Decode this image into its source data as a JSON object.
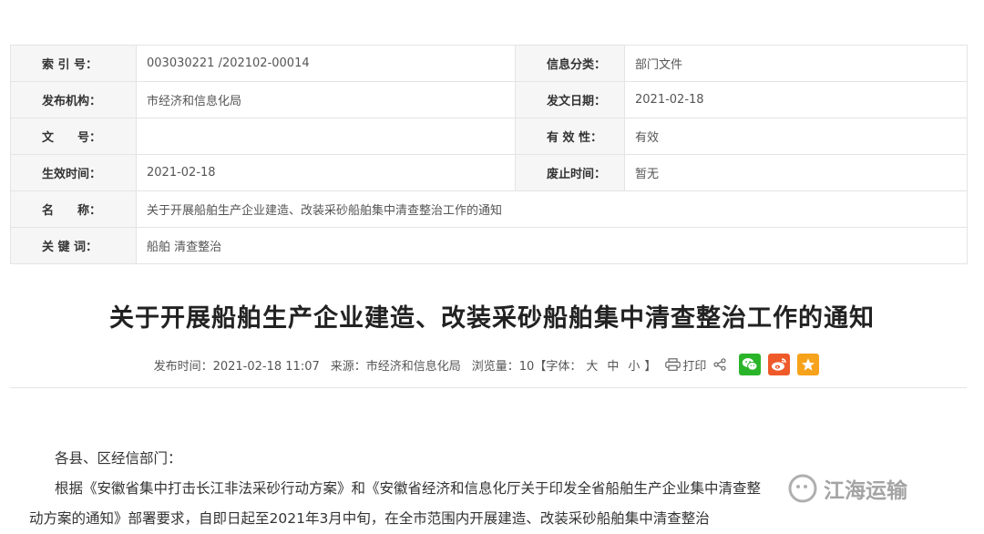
{
  "meta": {
    "index_no_label": "索 引 号：",
    "index_no": "003030221 /202102-00014",
    "category_label": "信息分类：",
    "category": "部门文件",
    "publisher_label": "发布机构：",
    "publisher": "市经济和信息化局",
    "issue_date_label": "发文日期：",
    "issue_date": "2021-02-18",
    "doc_no_label": "文　　号：",
    "doc_no": "",
    "validity_label": "有 效 性：",
    "validity": "有效",
    "effective_label": "生效时间：",
    "effective_date": "2021-02-18",
    "abolish_label": "废止时间：",
    "abolish": "暂无",
    "name_label": "名　　称：",
    "name": "关于开展船舶生产企业建造、改装采砂船舶集中清查整治工作的通知",
    "keywords_label": "关 键 词：",
    "keywords": "船舶 清查整治"
  },
  "article": {
    "title": "关于开展船舶生产企业建造、改装采砂船舶集中清查整治工作的通知",
    "publish_time": "发布时间：2021-02-18 11:07",
    "source": "来源：市经济和信息化局",
    "views": "浏览量：10",
    "font_label": "【字体：",
    "font_large": "大",
    "font_medium": "中",
    "font_small": "小",
    "font_close": "】",
    "print_label": "打印",
    "greeting": "各县、区经信部门：",
    "para1_line1": "根据《安徽省集中打击长江非法采砂行动方案》和《安徽省经济和信息化厅关于印发全省船舶生产企业集中清查整",
    "para1_line2": "动方案的通知》部署要求，自即日起至2021年3月中旬，在全市范围内开展建造、改装采砂船舶集中清查整治"
  },
  "watermark": {
    "text": "江海运输"
  },
  "colors": {
    "wechat": "#2ab42a",
    "weibo": "#ef5a2a",
    "favorite": "#f6a21b"
  },
  "icons": [
    "print-icon",
    "share-icon",
    "wechat-icon",
    "weibo-icon",
    "star-icon"
  ]
}
